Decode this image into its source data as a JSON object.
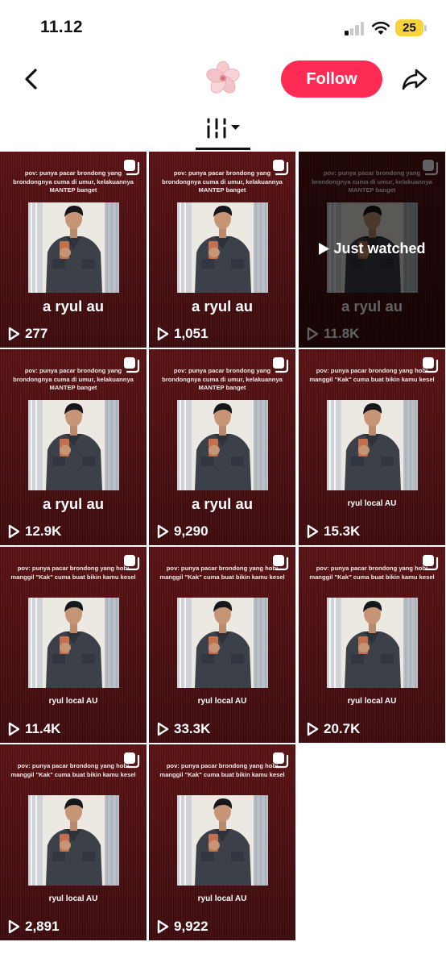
{
  "status_bar": {
    "time": "11.12",
    "battery": "25"
  },
  "header": {
    "follow_label": "Follow"
  },
  "icons": {
    "back": "chevron-left-icon",
    "share": "share-arrow-icon",
    "sort": "filter-icon",
    "avatar": "flower-icon",
    "play": "play-icon",
    "multi": "copy-icon"
  },
  "colors": {
    "follow": "#fe2c55",
    "tile": "#4b0d10"
  },
  "videos": [
    {
      "caption": "pov: punya pacar brondong yang brondongnya cuma di umur, kelakuannya MANTEP banget",
      "title": "a ryul au",
      "views": "277"
    },
    {
      "caption": "pov: punya pacar brondong yang brondongnya cuma di umur, kelakuannya MANTEP banget",
      "title": "a ryul au",
      "views": "1,051"
    },
    {
      "caption": "pov: punya pacar brondong yang brondongnya cuma di umur, kelakuannya MANTEP banget",
      "title": "a ryul au",
      "views": "11.8K",
      "watched_label": "Just watched"
    },
    {
      "caption": "pov: punya pacar brondong yang brondongnya cuma di umur, kelakuannya MANTEP banget",
      "title": "a ryul au",
      "views": "12.9K"
    },
    {
      "caption": "pov: punya pacar brondong yang brondongnya cuma di umur, kelakuannya MANTEP banget",
      "title": "a ryul au",
      "views": "9,290"
    },
    {
      "caption": "pov: punya pacar brondong yang hobi manggil \"Kak\" cuma buat bikin kamu kesel",
      "title": "ryul local AU",
      "views": "15.3K"
    },
    {
      "caption": "pov: punya pacar brondong yang hobi manggil \"Kak\" cuma buat bikin kamu kesel",
      "title": "ryul local AU",
      "views": "11.4K"
    },
    {
      "caption": "pov: punya pacar brondong yang hobi manggil \"Kak\" cuma buat bikin kamu kesel",
      "title": "ryul local AU",
      "views": "33.3K"
    },
    {
      "caption": "pov: punya pacar brondong yang hobi manggil \"Kak\" cuma buat bikin kamu kesel",
      "title": "ryul local AU",
      "views": "20.7K"
    },
    {
      "caption": "pov: punya pacar brondong yang hobi manggil \"Kak\" cuma buat bikin kamu kesel",
      "title": "ryul local AU",
      "views": "2,891"
    },
    {
      "caption": "pov: punya pacar brondong yang hobi manggil \"Kak\" cuma buat bikin kamu kesel",
      "title": "ryul local AU",
      "views": "9,922"
    }
  ]
}
